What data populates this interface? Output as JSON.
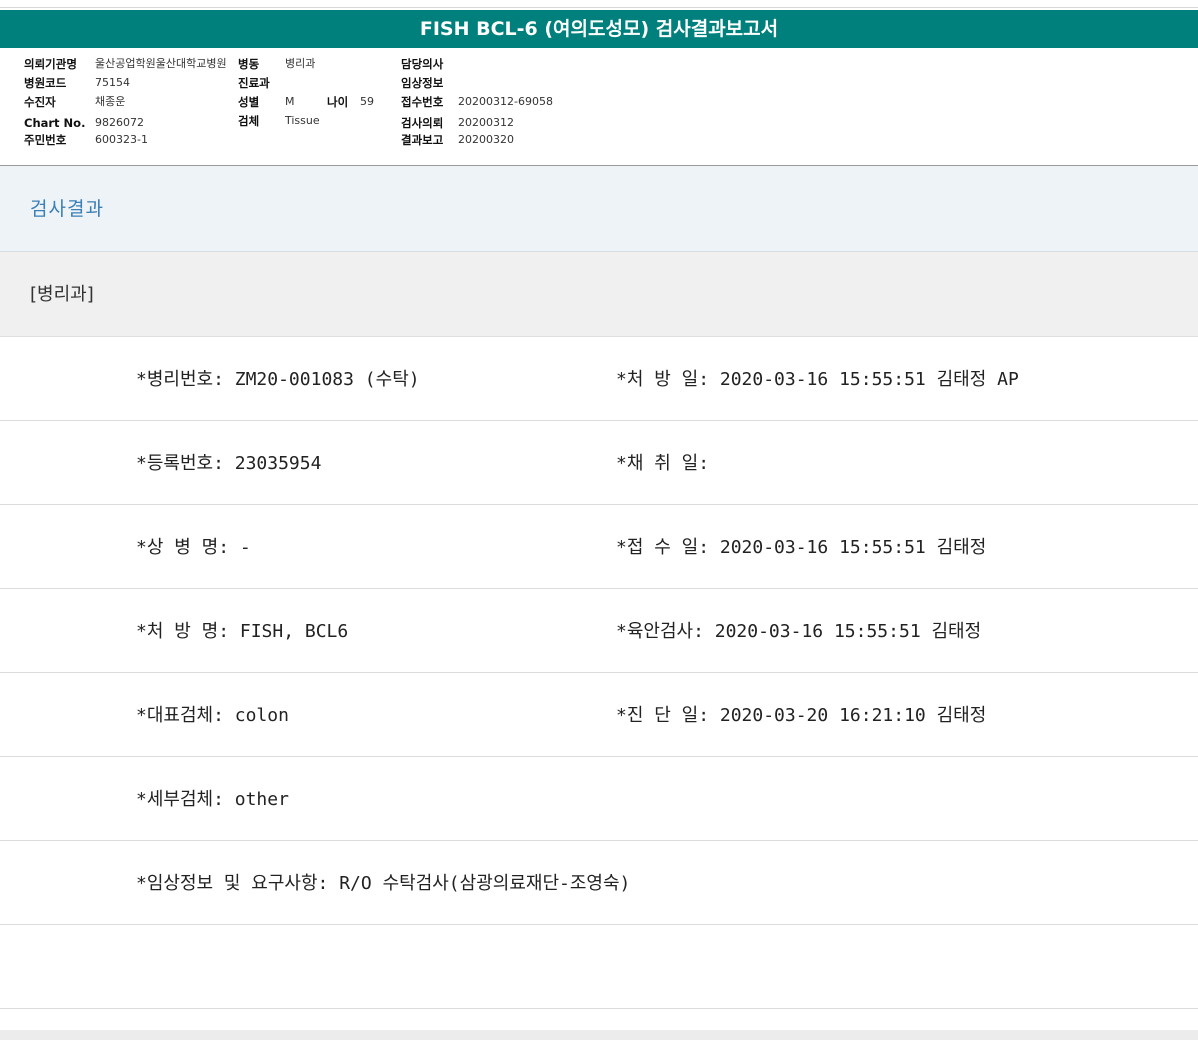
{
  "title": "FISH BCL-6 (여의도성모) 검사결과보고서",
  "header": {
    "col1": [
      {
        "label": "의뢰기관명",
        "value": "울산공업학원울산대학교병원"
      },
      {
        "label": "병원코드",
        "value": "75154"
      },
      {
        "label": "수진자",
        "value": "채종운"
      },
      {
        "label": "Chart No.",
        "value": "9826072"
      },
      {
        "label": "주민번호",
        "value": "600323-1"
      }
    ],
    "col2": [
      {
        "label": "병동",
        "value": "병리과"
      },
      {
        "label": "진료과",
        "value": ""
      },
      {
        "label": "성별",
        "value": "M"
      },
      {
        "label": "검체",
        "value": "Tissue"
      }
    ],
    "age": {
      "label": "나이",
      "value": "59"
    },
    "col3": [
      {
        "label": "담당의사",
        "value": ""
      },
      {
        "label": "임상정보",
        "value": ""
      },
      {
        "label": "접수번호",
        "value": "20200312-69058"
      },
      {
        "label": "검사의뢰",
        "value": "20200312"
      },
      {
        "label": "결과보고",
        "value": "20200320"
      }
    ]
  },
  "section_title": "검사결과",
  "department": "[병리과]",
  "rows": [
    {
      "left": "*병리번호: ZM20-001083 (수탁)",
      "right": "*처 방 일: 2020-03-16 15:55:51  김태정 AP"
    },
    {
      "left": "*등록번호: 23035954",
      "right": "*채 취 일:"
    },
    {
      "left": "*상 병 명: -",
      "right": "*접 수 일: 2020-03-16 15:55:51  김태정"
    },
    {
      "left": "*처 방 명: FISH, BCL6",
      "right": "*육안검사: 2020-03-16 15:55:51  김태정"
    },
    {
      "left": "*대표검체: colon",
      "right": "*진 단 일: 2020-03-20 16:21:10  김태정"
    },
    {
      "left": "*세부검체: other",
      "right": ""
    },
    {
      "left": "*임상정보 및 요구사항: R/O 수탁검사(삼광의료재단-조영숙)",
      "right": ""
    },
    {
      "left": "",
      "right": ""
    }
  ]
}
